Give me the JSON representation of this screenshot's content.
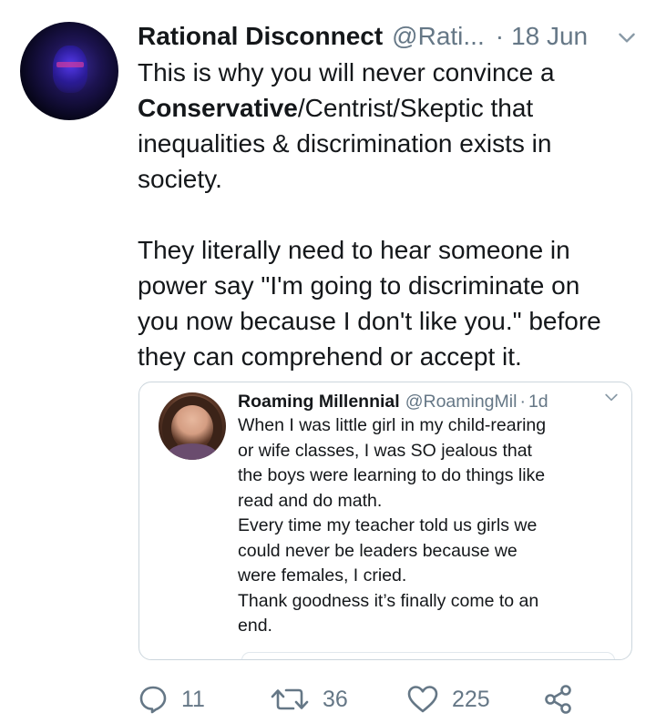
{
  "tweet": {
    "author_name": "Rational Disconnect",
    "author_handle": "@Rati...",
    "separator": "·",
    "date": "18 Jun",
    "lines_para1": [
      "This is why you will never convince a",
      "Conservative",
      "/Centrist/Skeptic that",
      "inequalities & discrimination exists in",
      "society."
    ],
    "lines_para2": [
      "They literally need to hear someone in",
      "power say \"I'm going to discriminate on",
      "you now because I don't like you.\" before",
      "they can comprehend or accept it."
    ]
  },
  "quoted": {
    "author_name": "Roaming Millennial",
    "author_handle": "@RoamingMil",
    "separator": "·",
    "date": "1d",
    "lines": [
      "When I was little girl in my child-rearing",
      "or wife classes, I was SO jealous that",
      "the boys were learning to do things like",
      "read and do math.",
      "Every time my teacher told us girls we",
      "could never be leaders because we",
      "were females, I cried.",
      "Thank goodness it’s finally come to an",
      "end."
    ]
  },
  "actions": {
    "reply_count": "11",
    "retweet_count": "36",
    "like_count": "225"
  },
  "icons": {
    "reply": "reply-icon",
    "retweet": "retweet-icon",
    "like": "heart-icon",
    "share": "share-icon",
    "menu": "chevron-down-icon"
  },
  "colors": {
    "text": "#14171a",
    "secondary": "#657786",
    "border": "#ccd6dd"
  }
}
